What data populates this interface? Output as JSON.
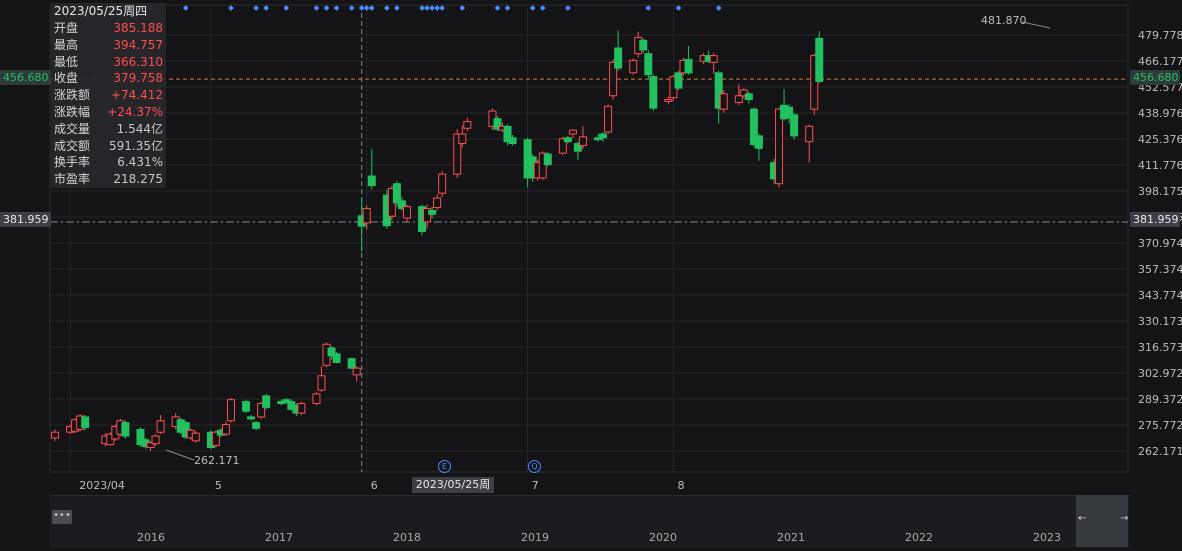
{
  "info": {
    "date": "2023/05/25周四",
    "rows": [
      {
        "key": "开盘",
        "value": "385.188",
        "tone": "red"
      },
      {
        "key": "最高",
        "value": "394.757",
        "tone": "red"
      },
      {
        "key": "最低",
        "value": "366.310",
        "tone": "red"
      },
      {
        "key": "收盘",
        "value": "379.758",
        "tone": "red"
      },
      {
        "key": "涨跌额",
        "value": "+74.412",
        "tone": "red"
      },
      {
        "key": "涨跌幅",
        "value": "+24.37%",
        "tone": "red"
      },
      {
        "key": "成交量",
        "value": "1.544亿",
        "tone": "plain"
      },
      {
        "key": "成交额",
        "value": "591.35亿",
        "tone": "plain"
      },
      {
        "key": "换手率",
        "value": "6.431%",
        "tone": "plain"
      },
      {
        "key": "市盈率",
        "value": "218.275",
        "tone": "plain"
      }
    ]
  },
  "axis": {
    "y_ticks": [
      "479.778",
      "466.177",
      "452.577",
      "438.976",
      "425.376",
      "411.776",
      "398.175",
      "384.575",
      "370.974",
      "357.374",
      "343.774",
      "330.173",
      "316.573",
      "302.972",
      "289.372",
      "275.772",
      "262.171"
    ],
    "current_price": "456.680",
    "crosshair_price": "381.959",
    "x_labels": [
      {
        "label": "2023/04",
        "date": "2023-04-03"
      },
      {
        "label": "5",
        "date": "2023-05-01"
      },
      {
        "label": "6",
        "date": "2023-06-01"
      },
      {
        "label": "7",
        "date": "2023-07-03"
      },
      {
        "label": "8",
        "date": "2023-08-01"
      }
    ],
    "crosshair_date": "2023/05/25周四",
    "max_label": "481.870",
    "min_label": "262.171"
  },
  "events": {
    "e_label": "E",
    "q_label": "Q"
  },
  "navigator": {
    "handle_label": "•••",
    "left_arrow": "←",
    "right_arrow": "→",
    "years": [
      "2016",
      "2017",
      "2018",
      "2019",
      "2020",
      "2021",
      "2022",
      "2023"
    ]
  },
  "colors": {
    "up": "#ff4d4f",
    "down": "#22c05e",
    "current_line": "#e07b2f",
    "crosshair": "#8a8a8a",
    "event_dot": "#4a8cff",
    "grid": "#26262a"
  },
  "chart_data": {
    "type": "candlestick",
    "ylim": [
      255,
      487
    ],
    "candles": [
      {
        "d": "2023-03-31",
        "o": 269.0,
        "c": 272.0,
        "h": 273.5,
        "l": 267.5
      },
      {
        "d": "2023-04-03",
        "o": 272.0,
        "c": 275.0,
        "h": 276.0,
        "l": 271.0
      },
      {
        "d": "2023-04-04",
        "o": 272.5,
        "c": 278.5,
        "h": 279.5,
        "l": 271.5
      },
      {
        "d": "2023-04-05",
        "o": 273.5,
        "c": 280.5,
        "h": 281.5,
        "l": 272.5
      },
      {
        "d": "2023-04-06",
        "o": 280.0,
        "c": 274.5,
        "h": 281.0,
        "l": 273.0
      },
      {
        "d": "2023-04-10",
        "o": 266.0,
        "c": 270.0,
        "h": 271.5,
        "l": 264.5
      },
      {
        "d": "2023-04-11",
        "o": 265.5,
        "c": 271.0,
        "h": 272.0,
        "l": 265.0
      },
      {
        "d": "2023-04-12",
        "o": 268.5,
        "c": 275.0,
        "h": 276.0,
        "l": 267.5
      },
      {
        "d": "2023-04-13",
        "o": 271.0,
        "c": 278.0,
        "h": 279.0,
        "l": 270.0
      },
      {
        "d": "2023-04-14",
        "o": 277.0,
        "c": 270.0,
        "h": 278.0,
        "l": 268.5
      },
      {
        "d": "2023-04-17",
        "o": 273.5,
        "c": 265.5,
        "h": 274.5,
        "l": 264.5
      },
      {
        "d": "2023-04-18",
        "o": 268.0,
        "c": 264.5,
        "h": 269.0,
        "l": 263.5
      },
      {
        "d": "2023-04-19",
        "o": 264.0,
        "c": 266.5,
        "h": 267.5,
        "l": 262.2
      },
      {
        "d": "2023-04-20",
        "o": 266.0,
        "c": 270.0,
        "h": 271.0,
        "l": 265.0
      },
      {
        "d": "2023-04-21",
        "o": 272.0,
        "c": 278.0,
        "h": 281.0,
        "l": 271.0
      },
      {
        "d": "2023-04-24",
        "o": 275.0,
        "c": 280.0,
        "h": 282.0,
        "l": 273.5
      },
      {
        "d": "2023-04-25",
        "o": 278.5,
        "c": 272.0,
        "h": 279.5,
        "l": 271.0
      },
      {
        "d": "2023-04-26",
        "o": 277.0,
        "c": 269.5,
        "h": 278.0,
        "l": 268.5
      },
      {
        "d": "2023-04-27",
        "o": 269.0,
        "c": 273.0,
        "h": 274.0,
        "l": 268.0
      },
      {
        "d": "2023-04-28",
        "o": 267.5,
        "c": 271.5,
        "h": 272.5,
        "l": 266.5
      },
      {
        "d": "2023-05-01",
        "o": 272.0,
        "c": 264.0,
        "h": 273.0,
        "l": 263.0
      },
      {
        "d": "2023-05-02",
        "o": 265.0,
        "c": 272.0,
        "h": 273.0,
        "l": 264.0
      },
      {
        "d": "2023-05-03",
        "o": 273.0,
        "c": 270.5,
        "h": 274.0,
        "l": 269.5
      },
      {
        "d": "2023-05-04",
        "o": 271.0,
        "c": 276.0,
        "h": 277.5,
        "l": 270.0
      },
      {
        "d": "2023-05-05",
        "o": 278.0,
        "c": 289.0,
        "h": 290.0,
        "l": 277.0
      },
      {
        "d": "2023-05-08",
        "o": 288.0,
        "c": 283.0,
        "h": 289.0,
        "l": 282.0
      },
      {
        "d": "2023-05-09",
        "o": 280.0,
        "c": 279.0,
        "h": 281.0,
        "l": 278.0
      },
      {
        "d": "2023-05-10",
        "o": 277.0,
        "c": 274.0,
        "h": 278.0,
        "l": 273.0
      },
      {
        "d": "2023-05-11",
        "o": 280.0,
        "c": 287.0,
        "h": 288.0,
        "l": 279.0
      },
      {
        "d": "2023-05-12",
        "o": 291.0,
        "c": 285.0,
        "h": 292.0,
        "l": 284.0
      },
      {
        "d": "2023-05-15",
        "o": 288.0,
        "c": 287.0,
        "h": 289.0,
        "l": 286.0
      },
      {
        "d": "2023-05-16",
        "o": 289.0,
        "c": 287.5,
        "h": 290.0,
        "l": 287.0
      },
      {
        "d": "2023-05-17",
        "o": 288.0,
        "c": 284.0,
        "h": 289.0,
        "l": 283.5
      },
      {
        "d": "2023-05-18",
        "o": 286.0,
        "c": 282.0,
        "h": 287.0,
        "l": 280.5
      },
      {
        "d": "2023-05-19",
        "o": 282.0,
        "c": 287.0,
        "h": 288.0,
        "l": 281.0
      },
      {
        "d": "2023-05-22",
        "o": 287.0,
        "c": 292.0,
        "h": 293.0,
        "l": 286.0
      },
      {
        "d": "2023-05-23",
        "o": 294.0,
        "c": 301.5,
        "h": 306.5,
        "l": 293.0
      },
      {
        "d": "2023-05-24",
        "o": 307.0,
        "c": 318.0,
        "h": 319.0,
        "l": 306.0
      },
      {
        "d": "2023-05-25",
        "o": 316.0,
        "c": 312.0,
        "h": 317.0,
        "l": 310.0
      },
      {
        "d": "2023-05-26",
        "o": 313.0,
        "c": 308.5,
        "h": 314.0,
        "l": 308.0
      },
      {
        "d": "2023-05-29",
        "o": 310.5,
        "c": 305.5,
        "h": 311.0,
        "l": 305.0
      },
      {
        "d": "2023-05-30",
        "o": 302.0,
        "c": 305.5,
        "h": 306.5,
        "l": 298.5
      },
      {
        "d": "2023-05-31",
        "o": 385.188,
        "c": 379.758,
        "h": 394.757,
        "l": 366.31
      },
      {
        "d": "2023-06-01",
        "o": 381.5,
        "c": 389.0,
        "h": 390.5,
        "l": 378.0
      },
      {
        "d": "2023-06-02",
        "o": 406.0,
        "c": 401.0,
        "h": 420.0,
        "l": 399.0
      },
      {
        "d": "2023-06-05",
        "o": 396.0,
        "c": 380.0,
        "h": 399.0,
        "l": 378.5
      },
      {
        "d": "2023-06-06",
        "o": 385.0,
        "c": 399.5,
        "h": 401.0,
        "l": 383.0
      },
      {
        "d": "2023-06-07",
        "o": 402.0,
        "c": 392.0,
        "h": 403.5,
        "l": 390.0
      },
      {
        "d": "2023-06-08",
        "o": 393.0,
        "c": 389.0,
        "h": 395.0,
        "l": 388.0
      },
      {
        "d": "2023-06-09",
        "o": 384.0,
        "c": 390.0,
        "h": 391.0,
        "l": 382.0
      },
      {
        "d": "2023-06-12",
        "o": 390.0,
        "c": 377.0,
        "h": 391.0,
        "l": 375.0
      },
      {
        "d": "2023-06-13",
        "o": 382.0,
        "c": 389.0,
        "h": 391.0,
        "l": 378.5
      },
      {
        "d": "2023-06-14",
        "o": 388.0,
        "c": 386.0,
        "h": 390.0,
        "l": 384.0
      },
      {
        "d": "2023-06-15",
        "o": 389.5,
        "c": 394.5,
        "h": 396.5,
        "l": 388.0
      },
      {
        "d": "2023-06-16",
        "o": 397.0,
        "c": 407.0,
        "h": 408.5,
        "l": 395.0
      },
      {
        "d": "2023-06-19",
        "o": 407.0,
        "c": 428.0,
        "h": 430.5,
        "l": 405.0
      },
      {
        "d": "2023-06-20",
        "o": 423.0,
        "c": 428.0,
        "h": 432.5,
        "l": 421.0
      },
      {
        "d": "2023-06-21",
        "o": 431.0,
        "c": 434.5,
        "h": 436.5,
        "l": 429.5
      },
      {
        "d": "2023-06-26",
        "o": 432.0,
        "c": 440.0,
        "h": 441.5,
        "l": 430.0
      },
      {
        "d": "2023-06-27",
        "o": 436.0,
        "c": 430.5,
        "h": 437.5,
        "l": 429.5
      },
      {
        "d": "2023-06-28",
        "o": 430.0,
        "c": 432.0,
        "h": 434.0,
        "l": 429.0
      },
      {
        "d": "2023-06-29",
        "o": 432.0,
        "c": 424.0,
        "h": 433.0,
        "l": 422.0
      },
      {
        "d": "2023-06-30",
        "o": 426.0,
        "c": 423.0,
        "h": 427.5,
        "l": 422.0
      },
      {
        "d": "2023-07-03",
        "o": 425.0,
        "c": 405.0,
        "h": 426.0,
        "l": 400.0
      },
      {
        "d": "2023-07-04",
        "o": 416.0,
        "c": 405.0,
        "h": 417.5,
        "l": 403.0
      },
      {
        "d": "2023-07-05",
        "o": 405.0,
        "c": 413.0,
        "h": 414.5,
        "l": 403.5
      },
      {
        "d": "2023-07-06",
        "o": 405.0,
        "c": 418.0,
        "h": 419.0,
        "l": 404.0
      },
      {
        "d": "2023-07-07",
        "o": 417.5,
        "c": 412.0,
        "h": 418.5,
        "l": 411.0
      },
      {
        "d": "2023-07-10",
        "o": 418.0,
        "c": 425.5,
        "h": 426.5,
        "l": 417.0
      },
      {
        "d": "2023-07-11",
        "o": 426.0,
        "c": 424.0,
        "h": 427.0,
        "l": 423.0
      },
      {
        "d": "2023-07-12",
        "o": 428.0,
        "c": 430.0,
        "h": 430.5,
        "l": 426.0
      },
      {
        "d": "2023-07-13",
        "o": 423.0,
        "c": 419.0,
        "h": 424.0,
        "l": 414.5
      },
      {
        "d": "2023-07-14",
        "o": 422.0,
        "c": 426.5,
        "h": 432.0,
        "l": 420.0
      },
      {
        "d": "2023-07-17",
        "o": 426.0,
        "c": 425.0,
        "h": 428.0,
        "l": 424.0
      },
      {
        "d": "2023-07-18",
        "o": 428.0,
        "c": 426.0,
        "h": 429.0,
        "l": 424.0
      },
      {
        "d": "2023-07-19",
        "o": 429.0,
        "c": 442.5,
        "h": 443.5,
        "l": 428.0
      },
      {
        "d": "2023-07-20",
        "o": 448.0,
        "c": 465.5,
        "h": 467.0,
        "l": 446.0
      },
      {
        "d": "2023-07-21",
        "o": 473.0,
        "c": 462.5,
        "h": 482.0,
        "l": 461.0
      },
      {
        "d": "2023-07-24",
        "o": 460.0,
        "c": 466.5,
        "h": 467.5,
        "l": 459.0
      },
      {
        "d": "2023-07-25",
        "o": 470.0,
        "c": 478.5,
        "h": 481.5,
        "l": 468.0
      },
      {
        "d": "2023-07-26",
        "o": 477.0,
        "c": 472.0,
        "h": 478.0,
        "l": 470.5
      },
      {
        "d": "2023-07-27",
        "o": 470.0,
        "c": 459.0,
        "h": 472.0,
        "l": 457.0
      },
      {
        "d": "2023-07-28",
        "o": 458.0,
        "c": 441.5,
        "h": 459.0,
        "l": 440.0
      },
      {
        "d": "2023-07-31",
        "o": 445.0,
        "c": 446.0,
        "h": 447.5,
        "l": 443.5
      },
      {
        "d": "2023-08-01",
        "o": 447.0,
        "c": 458.0,
        "h": 459.0,
        "l": 445.5
      },
      {
        "d": "2023-08-02",
        "o": 460.0,
        "c": 452.0,
        "h": 461.0,
        "l": 451.0
      },
      {
        "d": "2023-08-03",
        "o": 460.0,
        "c": 466.5,
        "h": 468.0,
        "l": 458.5
      },
      {
        "d": "2023-08-04",
        "o": 467.0,
        "c": 460.0,
        "h": 474.0,
        "l": 459.0
      },
      {
        "d": "2023-08-07",
        "o": 466.0,
        "c": 469.0,
        "h": 470.5,
        "l": 464.5
      },
      {
        "d": "2023-08-08",
        "o": 469.0,
        "c": 466.0,
        "h": 471.5,
        "l": 465.0
      },
      {
        "d": "2023-08-09",
        "o": 465.5,
        "c": 469.0,
        "h": 470.5,
        "l": 459.5
      },
      {
        "d": "2023-08-10",
        "o": 460.0,
        "c": 441.5,
        "h": 461.0,
        "l": 433.5
      },
      {
        "d": "2023-08-11",
        "o": 441.0,
        "c": 449.0,
        "h": 451.0,
        "l": 439.0
      },
      {
        "d": "2023-08-14",
        "o": 444.5,
        "c": 448.0,
        "h": 454.0,
        "l": 443.0
      },
      {
        "d": "2023-08-15",
        "o": 448.0,
        "c": 451.0,
        "h": 452.0,
        "l": 446.5
      },
      {
        "d": "2023-08-16",
        "o": 449.0,
        "c": 446.0,
        "h": 450.0,
        "l": 444.0
      },
      {
        "d": "2023-08-17",
        "o": 441.0,
        "c": 422.5,
        "h": 442.0,
        "l": 421.0
      },
      {
        "d": "2023-08-18",
        "o": 427.0,
        "c": 420.5,
        "h": 428.0,
        "l": 414.0
      },
      {
        "d": "2023-08-21",
        "o": 413.0,
        "c": 404.5,
        "h": 415.0,
        "l": 402.0
      },
      {
        "d": "2023-08-22",
        "o": 402.0,
        "c": 441.0,
        "h": 442.0,
        "l": 400.0
      },
      {
        "d": "2023-08-23",
        "o": 443.0,
        "c": 436.0,
        "h": 451.5,
        "l": 435.0
      },
      {
        "d": "2023-08-24",
        "o": 442.0,
        "c": 436.5,
        "h": 443.5,
        "l": 433.5
      },
      {
        "d": "2023-08-25",
        "o": 438.0,
        "c": 427.0,
        "h": 439.0,
        "l": 425.0
      },
      {
        "d": "2023-08-28",
        "o": 424.0,
        "c": 432.0,
        "h": 433.0,
        "l": 413.0
      },
      {
        "d": "2023-08-29",
        "o": 441.0,
        "c": 469.0,
        "h": 470.0,
        "l": 438.0
      },
      {
        "d": "2023-08-30",
        "o": 478.0,
        "c": 455.5,
        "h": 481.87,
        "l": 454.5
      }
    ],
    "event_dot_dates": [
      "2023-04-12",
      "2023-04-26",
      "2023-05-05",
      "2023-05-10",
      "2023-05-12",
      "2023-05-16",
      "2023-05-22",
      "2023-05-24",
      "2023-05-26",
      "2023-05-29",
      "2023-05-31",
      "2023-06-01",
      "2023-06-02",
      "2023-06-05",
      "2023-06-07",
      "2023-06-12",
      "2023-06-13",
      "2023-06-14",
      "2023-06-15",
      "2023-06-16",
      "2023-06-20",
      "2023-06-27",
      "2023-06-29",
      "2023-07-04",
      "2023-07-06",
      "2023-07-11",
      "2023-07-27",
      "2023-08-02",
      "2023-08-10"
    ]
  }
}
